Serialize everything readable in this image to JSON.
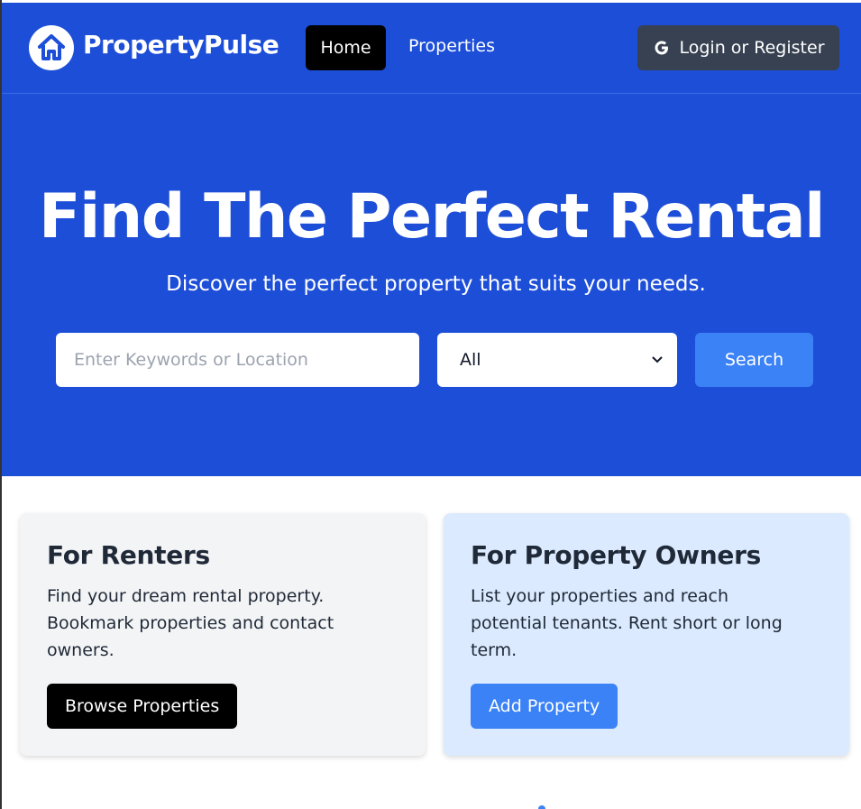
{
  "nav": {
    "brand": "PropertyPulse",
    "links": [
      "Home",
      "Properties"
    ],
    "login_label": "Login or Register"
  },
  "hero": {
    "title": "Find The Perfect Rental",
    "subtitle": "Discover the perfect property that suits your needs.",
    "search_placeholder": "Enter Keywords or Location",
    "type_selected": "All",
    "search_label": "Search"
  },
  "cards": {
    "renters": {
      "title": "For Renters",
      "text": "Find your dream rental property. Bookmark properties and contact owners.",
      "button": "Browse Properties"
    },
    "owners": {
      "title": "For Property Owners",
      "text": "List your properties and reach potential tenants. Rent short or long term.",
      "button": "Add Property"
    }
  },
  "colors": {
    "primary": "#1d4ed8",
    "accent": "#3b82f6",
    "dark_button": "#374151",
    "renters_card": "#f3f4f6",
    "owners_card": "#dbeafe"
  },
  "icons": {
    "logo": "house-icon",
    "login": "google-icon",
    "select": "chevron-down-icon"
  }
}
